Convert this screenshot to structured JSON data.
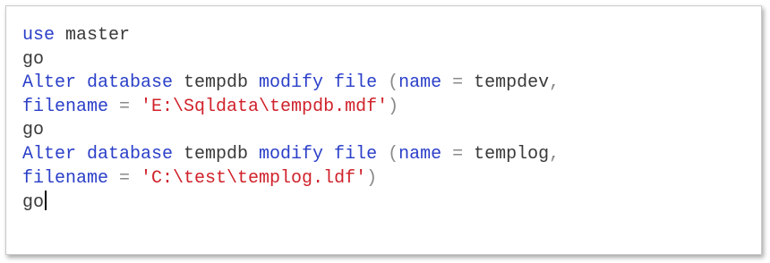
{
  "editor": {
    "lines": [
      [
        {
          "t": "kw",
          "v": "use"
        },
        {
          "t": "plain",
          "v": " master"
        }
      ],
      [
        {
          "t": "plain",
          "v": "go"
        }
      ],
      [
        {
          "t": "kw",
          "v": "Alter database"
        },
        {
          "t": "plain",
          "v": " tempdb "
        },
        {
          "t": "kw",
          "v": "modify file"
        },
        {
          "t": "op",
          "v": " ("
        },
        {
          "t": "kw",
          "v": "name"
        },
        {
          "t": "op",
          "v": " = "
        },
        {
          "t": "plain",
          "v": "tempdev"
        },
        {
          "t": "op",
          "v": ","
        }
      ],
      [
        {
          "t": "kw",
          "v": "filename"
        },
        {
          "t": "op",
          "v": " = "
        },
        {
          "t": "str",
          "v": "'E:\\Sqldata\\tempdb.mdf'"
        },
        {
          "t": "op",
          "v": ")"
        }
      ],
      [
        {
          "t": "plain",
          "v": "go"
        }
      ],
      [
        {
          "t": "kw",
          "v": "Alter database"
        },
        {
          "t": "plain",
          "v": " tempdb "
        },
        {
          "t": "kw",
          "v": "modify file"
        },
        {
          "t": "op",
          "v": " ("
        },
        {
          "t": "kw",
          "v": "name"
        },
        {
          "t": "op",
          "v": " = "
        },
        {
          "t": "plain",
          "v": "templog"
        },
        {
          "t": "op",
          "v": ","
        }
      ],
      [
        {
          "t": "kw",
          "v": "filename"
        },
        {
          "t": "op",
          "v": " = "
        },
        {
          "t": "str",
          "v": "'C:\\test\\templog.ldf'"
        },
        {
          "t": "op",
          "v": ")"
        }
      ],
      [
        {
          "t": "plain",
          "v": "go"
        }
      ]
    ],
    "caret_line": 7,
    "colors": {
      "keyword": "#2a3fc8",
      "string": "#d0222b",
      "operator": "#8a8a8a",
      "text": "#3a3a3a"
    }
  }
}
